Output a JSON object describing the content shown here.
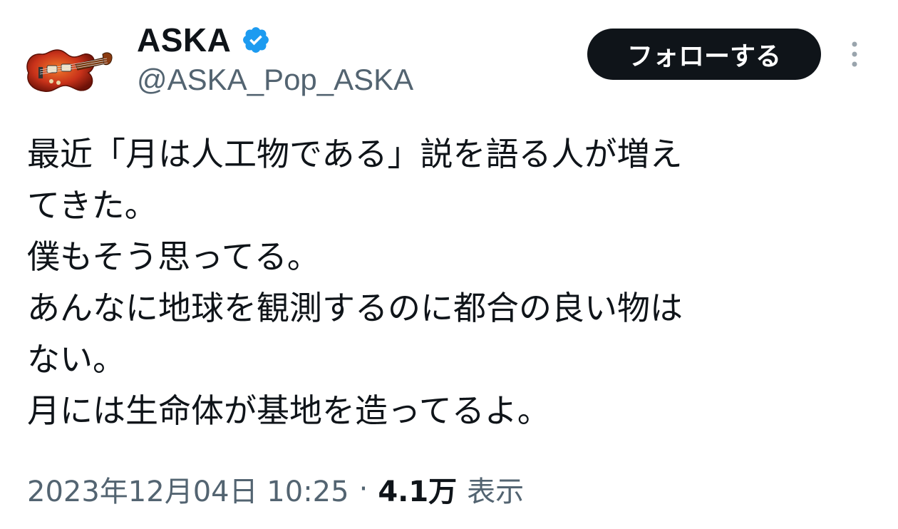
{
  "author": {
    "display_name": "ASKA",
    "handle": "@ASKA_Pop_ASKA",
    "verified": true,
    "verified_color": "#1d9bf0",
    "avatar": "violin-bass-guitar"
  },
  "follow_button": {
    "label": "フォローする",
    "background": "#0f1419",
    "text_color": "#ffffff"
  },
  "more_menu": {
    "icon": "vertical-ellipsis-icon"
  },
  "tweet": {
    "lines": [
      "最近「月は人工物である」説を語る人が増え",
      "てきた。",
      "僕もそう思ってる。",
      "あんなに地球を観測するのに都合の良い物は",
      "ない。",
      "月には生命体が基地を造ってるよ。"
    ]
  },
  "meta": {
    "timestamp": "2023年12月04日 10:25",
    "separator": "·",
    "views_count": "4.1万",
    "views_label": "表示"
  },
  "colors": {
    "text_primary": "#0f1419",
    "text_secondary": "#536471"
  }
}
